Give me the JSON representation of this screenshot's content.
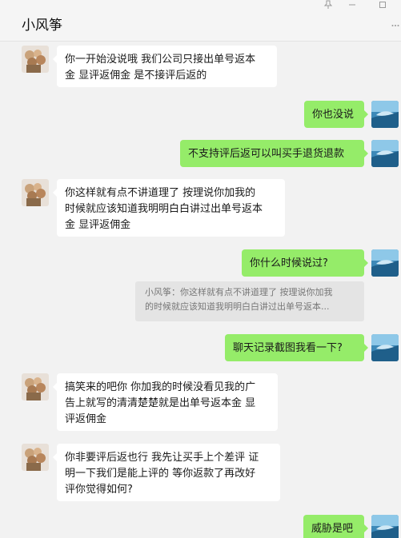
{
  "header": {
    "title": "小风筝"
  },
  "window": {
    "pin_icon": "pin-icon",
    "minimize_icon": "minimize-icon",
    "maximize_icon": "maximize-icon",
    "more_icon": "more-dots-icon"
  },
  "colors": {
    "outgoing_bubble": "#95ec69",
    "incoming_bubble": "#ffffff",
    "chat_bg": "#f2f2f2"
  },
  "messages": [
    {
      "side": "in",
      "lines": [
        "你一开始没说哦 我们公司只接出单号返本",
        "金 显评返佣金 是不接评后返的"
      ]
    },
    {
      "side": "out",
      "lines": [
        "你也没说"
      ]
    },
    {
      "side": "out",
      "lines": [
        "不支持评后返可以叫买手退货退款"
      ]
    },
    {
      "side": "in",
      "lines": [
        "你这样就有点不讲道理了 按理说你加我的",
        "时候就应该知道我明明白白讲过出单号返本",
        "金 显评返佣金"
      ]
    },
    {
      "side": "out",
      "lines": [
        "你什么时候说过?"
      ]
    },
    {
      "side": "out",
      "lines": [
        "聊天记录截图我看一下?"
      ]
    },
    {
      "side": "in",
      "lines": [
        "搞笑来的吧你 你加我的时候没看见我的广",
        "告上就写的清清楚楚就是出单号返本金 显",
        "评返佣金"
      ]
    },
    {
      "side": "in",
      "lines": [
        "你非要评后返也行 我先让买手上个差评 证",
        "明一下我们是能上评的 等你返款了再改好",
        "评你觉得如何?"
      ]
    },
    {
      "side": "out",
      "lines": [
        "威胁是吧"
      ]
    }
  ],
  "quote": {
    "lines": [
      "小风筝：你这样就有点不讲道理了 按理说你加我",
      "的时候就应该知道我明明白白讲过出单号返本..."
    ]
  }
}
